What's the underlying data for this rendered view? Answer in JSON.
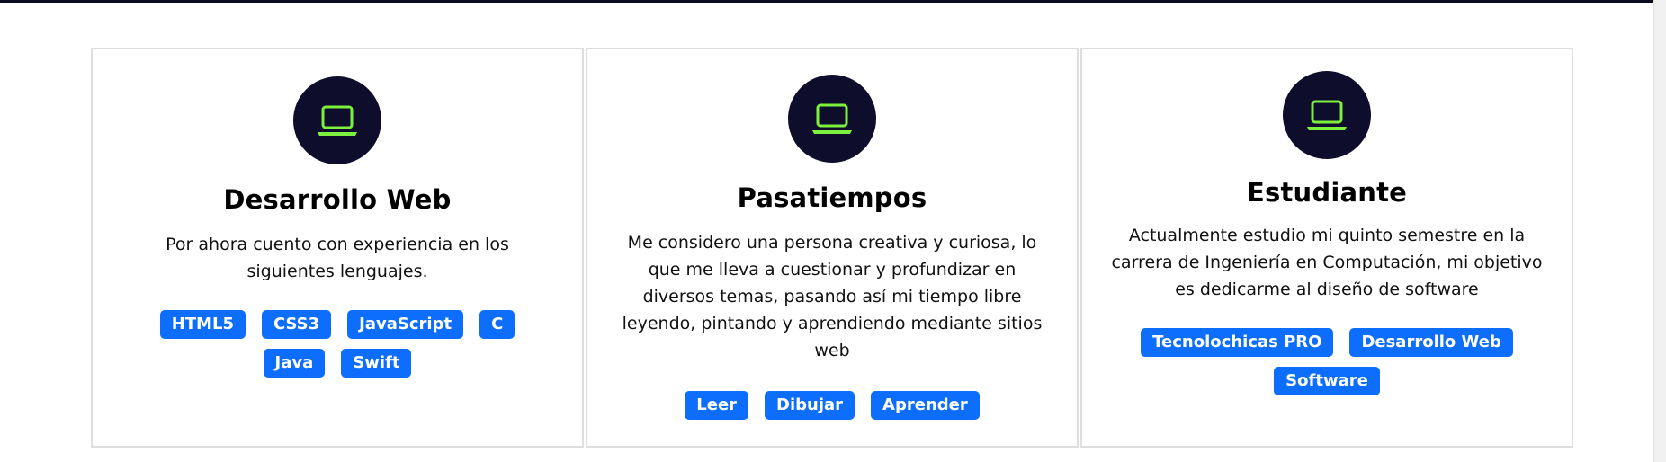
{
  "colors": {
    "icon_circle": "#0e0e2c",
    "icon_stroke": "#7cf03c",
    "tag_bg": "#0d6efd",
    "tag_text": "#ffffff",
    "card_border": "#dedede"
  },
  "cards": [
    {
      "icon": "laptop-icon",
      "title": "Desarrollo Web",
      "description": "Por ahora cuento con experiencia en los siguientes lenguajes.",
      "tags": [
        "HTML5",
        "CSS3",
        "JavaScript",
        "C",
        "Java",
        "Swift"
      ]
    },
    {
      "icon": "laptop-icon",
      "title": "Pasatiempos",
      "description": "Me considero una persona creativa y curiosa, lo que me lleva a cuestionar y profundizar en diversos temas, pasando así mi tiempo libre leyendo, pintando y aprendiendo mediante sitios web",
      "tags": [
        "Leer",
        "Dibujar",
        "Aprender"
      ]
    },
    {
      "icon": "laptop-icon",
      "title": "Estudiante",
      "description": "Actualmente estudio mi quinto semestre en la carrera de Ingeniería en Computación, mi objetivo es dedicarme al diseño de software",
      "tags": [
        "Tecnolochicas PRO",
        "Desarrollo Web",
        "Software"
      ]
    }
  ]
}
